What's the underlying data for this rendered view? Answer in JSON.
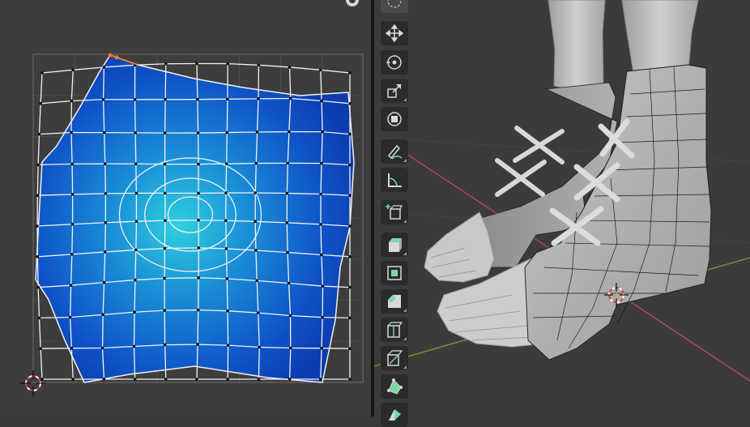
{
  "uv_editor": {
    "background_color": "#3d3d3d",
    "grid_color": "#555555",
    "island_fill_dark": "#0d3fb8",
    "island_fill_light": "#29c6d8",
    "edge_color": "#f2f2f2",
    "selected_vertex_color": "#ff7a1a",
    "cursor": "2d-cursor-icon"
  },
  "viewport": {
    "background_color": "#3b3b3b",
    "x_axis_color": "#b54a55",
    "y_axis_color": "#6f9a3a",
    "model_color": "#bdbdbd",
    "cursor": "3d-cursor-icon"
  },
  "toolbar": {
    "tools": [
      {
        "name": "select-tool",
        "icon": "select-box-icon",
        "group": "transform"
      },
      {
        "name": "move-tool",
        "icon": "move-icon",
        "group": "transform"
      },
      {
        "name": "rotate-tool",
        "icon": "rotate-icon",
        "group": "transform"
      },
      {
        "name": "scale-tool",
        "icon": "scale-icon",
        "group": "transform"
      },
      {
        "name": "transform-tool",
        "icon": "transform-icon",
        "group": "transform"
      },
      {
        "name": "annotate-tool",
        "icon": "annotate-icon",
        "group": "annotate"
      },
      {
        "name": "measure-tool",
        "icon": "measure-icon",
        "group": "annotate"
      },
      {
        "name": "add-cube-tool",
        "icon": "add-cube-icon",
        "group": "add"
      },
      {
        "name": "extrude-tool",
        "icon": "extrude-region-icon",
        "group": "edit"
      },
      {
        "name": "inset-tool",
        "icon": "inset-faces-icon",
        "group": "edit"
      },
      {
        "name": "bevel-tool",
        "icon": "bevel-icon",
        "group": "edit"
      },
      {
        "name": "loop-cut-tool",
        "icon": "loop-cut-icon",
        "group": "edit"
      },
      {
        "name": "knife-tool",
        "icon": "knife-icon",
        "group": "edit"
      },
      {
        "name": "poly-build-tool",
        "icon": "poly-build-icon",
        "group": "edit"
      },
      {
        "name": "spin-tool",
        "icon": "spin-icon",
        "group": "edit"
      }
    ],
    "accent_transform": "#d8d8d8",
    "accent_edit": "#7fd6a2"
  }
}
